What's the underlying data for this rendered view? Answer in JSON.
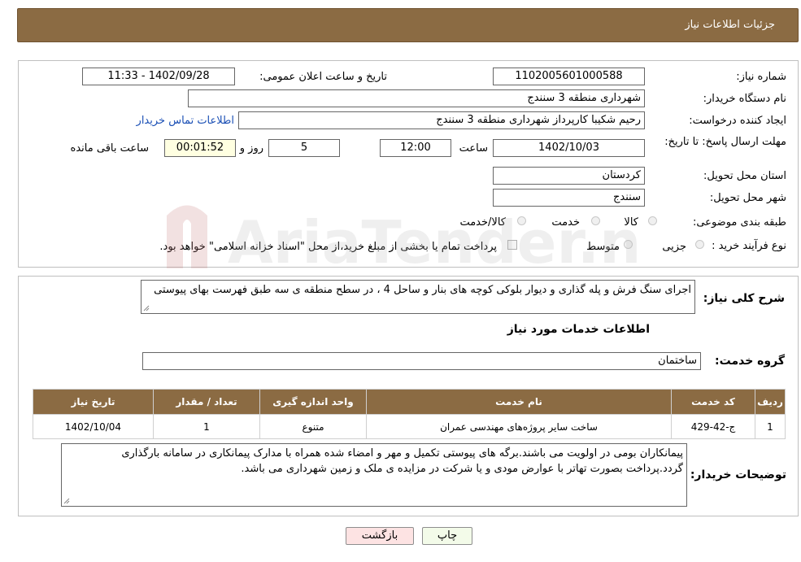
{
  "header": {
    "title": "جزئیات اطلاعات نیاز"
  },
  "form": {
    "need_number": {
      "label": "شماره نیاز:",
      "value": "1102005601000588"
    },
    "announce_datetime": {
      "label": "تاریخ و ساعت اعلان عمومی:",
      "value": "1402/09/28 - 11:33"
    },
    "buyer_org": {
      "label": "نام دستگاه خریدار:",
      "value": "شهرداری منطقه 3 سنندج"
    },
    "requester": {
      "label": "ایجاد کننده درخواست:",
      "value": "رحیم شکیبا کارپرداز شهرداری منطقه 3 سنندج",
      "contact_link": "اطلاعات تماس خریدار"
    },
    "deadline": {
      "label": "مهلت ارسال پاسخ: تا تاریخ:",
      "date": "1402/10/03",
      "time_label": "ساعت",
      "time": "12:00",
      "days": "5",
      "days_label": "روز و",
      "remaining": "00:01:52",
      "remaining_label": "ساعت باقی مانده"
    },
    "province": {
      "label": "استان محل تحویل:",
      "value": "کردستان"
    },
    "city": {
      "label": "شهر محل تحویل:",
      "value": "سنندج"
    },
    "category": {
      "label": "طبقه بندی موضوعی:",
      "options": [
        "کالا",
        "خدمت",
        "کالا/خدمت"
      ]
    },
    "purchase_process": {
      "label": "نوع فرآیند خرید :",
      "options": [
        "جزیی",
        "متوسط"
      ],
      "checkbox_text": "پرداخت تمام یا بخشی از مبلغ خرید،از محل \"اسناد خزانه اسلامی\" خواهد بود."
    }
  },
  "description": {
    "label": "شرح کلی نیاز:",
    "value": "اجرای سنگ فرش و پله گذاری و دیوار بلوکی کوچه های بنار و ساحل 4 ، در سطح منطقه ی سه طبق فهرست بهای پیوستی"
  },
  "services_section": {
    "title": "اطلاعات خدمات مورد نیاز",
    "group_label": "گروه خدمت:",
    "group_value": "ساختمان"
  },
  "table": {
    "headers": [
      "ردیف",
      "کد خدمت",
      "نام خدمت",
      "واحد اندازه گیری",
      "تعداد / مقدار",
      "تاریخ نیاز"
    ],
    "rows": [
      [
        "1",
        "ج-42-429",
        "ساخت سایر پروژه‌های مهندسی عمران",
        "متنوع",
        "1",
        "1402/10/04"
      ]
    ]
  },
  "buyer_notes": {
    "label": "توضیحات خریدار:",
    "value": "پیمانکاران بومی در اولویت می باشند.برگه های پیوستی تکمیل و مهر و امضاء شده همراه با مدارک پیمانکاری  در سامانه بارگذاری گردد.پرداخت بصورت تهاتر با عوارض مودی و یا شرکت در مزایده ی ملک و زمین شهرداری می باشد."
  },
  "buttons": {
    "print": "چاپ",
    "back": "بازگشت"
  },
  "watermark": {
    "text": "AriaTender.neT"
  }
}
